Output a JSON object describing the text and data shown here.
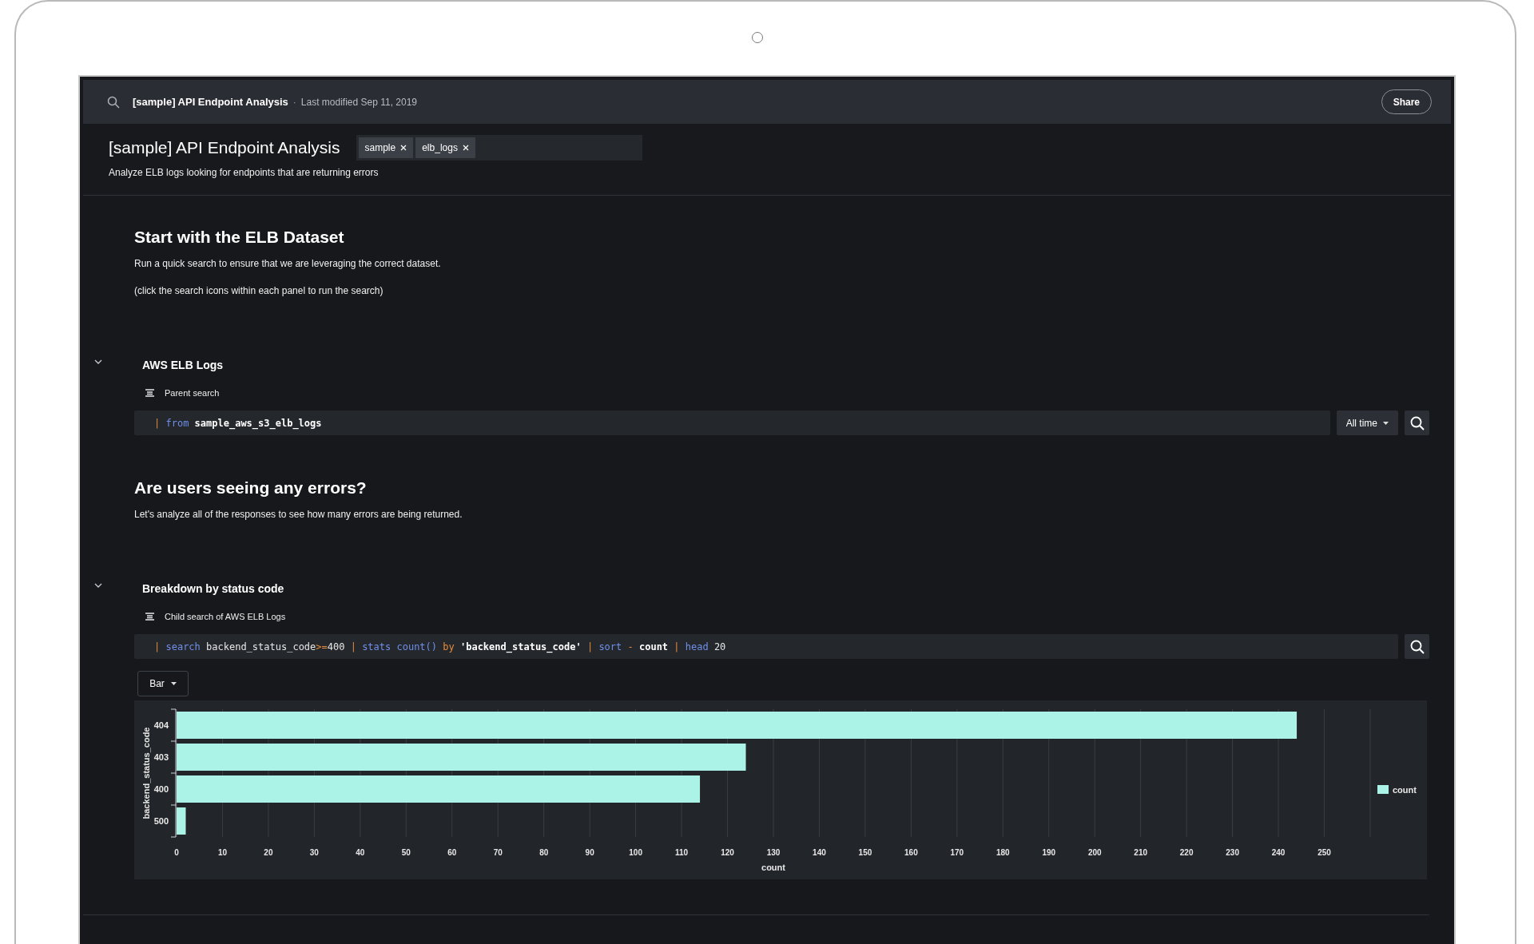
{
  "top_bar": {
    "title": "[sample] API Endpoint Analysis",
    "separator": "·",
    "modified": "Last modified Sep 11, 2019",
    "share_button": "Share"
  },
  "header": {
    "title": "[sample] API Endpoint Analysis",
    "tags": [
      "sample",
      "elb_logs"
    ],
    "description": "Analyze ELB logs looking for endpoints that are returning errors"
  },
  "sections": [
    {
      "kind": "text",
      "heading": "Start with the ELB Dataset",
      "paragraphs": [
        "Run a quick search to ensure that we are leveraging the correct dataset.",
        "(click the search icons within each panel to run the search)"
      ]
    },
    {
      "kind": "panel",
      "expanded": true,
      "title": "AWS ELB Logs",
      "subtitle": "Parent search",
      "time_range": "All time",
      "query": [
        {
          "text": "| ",
          "kind": "pipe"
        },
        {
          "text": "from ",
          "kind": "keyword"
        },
        {
          "text": "sample_aws_s3_elb_logs",
          "kind": "literal"
        }
      ]
    },
    {
      "kind": "text",
      "heading": "Are users seeing any errors?",
      "paragraphs": [
        "Let's analyze all of the responses to see how many errors are being returned."
      ]
    },
    {
      "kind": "panel",
      "expanded": true,
      "title": "Breakdown by status code",
      "subtitle": "Child search of AWS ELB Logs",
      "view": "Bar",
      "query": [
        {
          "text": "| ",
          "kind": "pipe"
        },
        {
          "text": "search ",
          "kind": "keyword"
        },
        {
          "text": "backend_status_code",
          "kind": "plain"
        },
        {
          "text": ">=",
          "kind": "op"
        },
        {
          "text": "400 ",
          "kind": "plain"
        },
        {
          "text": "| ",
          "kind": "pipe"
        },
        {
          "text": "stats count() ",
          "kind": "keyword"
        },
        {
          "text": "by ",
          "kind": "op"
        },
        {
          "text": "'backend_status_code' ",
          "kind": "literal"
        },
        {
          "text": "| ",
          "kind": "pipe"
        },
        {
          "text": "sort ",
          "kind": "keyword"
        },
        {
          "text": "- ",
          "kind": "op"
        },
        {
          "text": "count ",
          "kind": "literal"
        },
        {
          "text": "| ",
          "kind": "pipe"
        },
        {
          "text": "head ",
          "kind": "keyword"
        },
        {
          "text": "20",
          "kind": "plain"
        }
      ],
      "chart_data": {
        "type": "bar",
        "orientation": "horizontal",
        "xlabel": "count",
        "ylabel": "backend_status_code",
        "categories": [
          "404",
          "403",
          "400",
          "500"
        ],
        "series": [
          {
            "name": "count",
            "color": "#aaf3e6",
            "values": [
              244,
              124,
              114,
              2
            ]
          }
        ],
        "grid": true,
        "xlim": [
          0,
          260
        ],
        "xticks": [
          0,
          10,
          20,
          30,
          40,
          50,
          60,
          70,
          80,
          90,
          100,
          110,
          120,
          130,
          140,
          150,
          160,
          170,
          180,
          190,
          200,
          210,
          220,
          230,
          240,
          250
        ]
      }
    }
  ]
}
